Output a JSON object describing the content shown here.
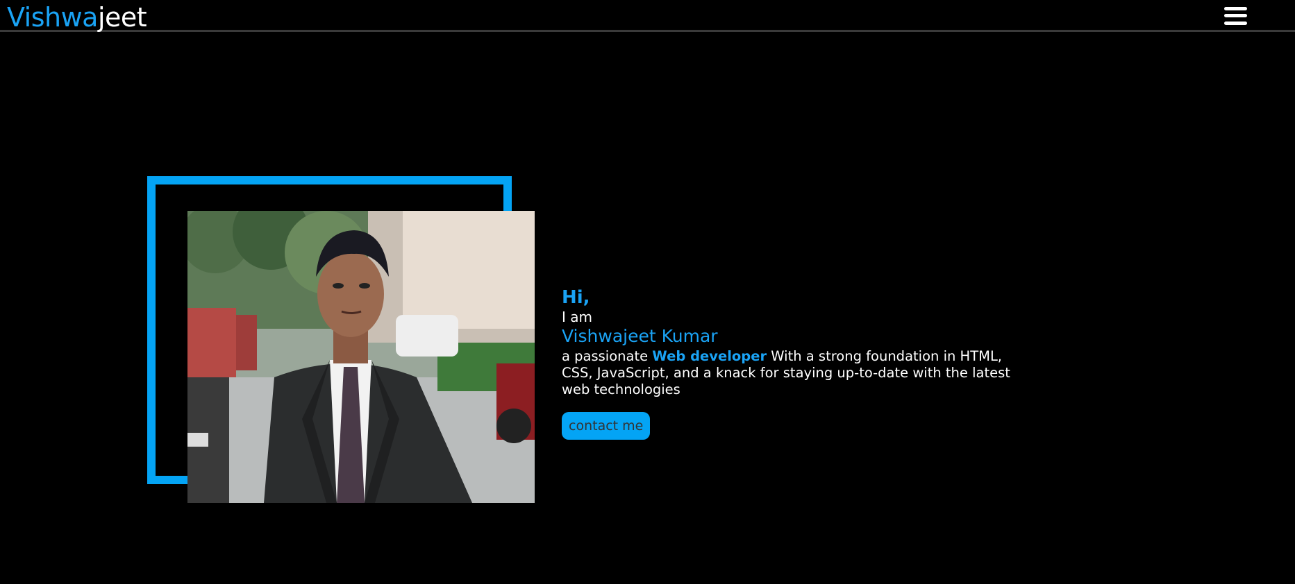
{
  "header": {
    "logo_part1": "Vishwa",
    "logo_part2": "jeet",
    "menu_icon": "hamburger-menu-icon"
  },
  "hero": {
    "greeting": "Hi,",
    "iam": "I am",
    "name": "Vishwajeet Kumar",
    "desc_prefix": "a passionate ",
    "desc_highlight": "Web developer",
    "desc_suffix": " With a strong foundation in HTML, CSS, JavaScript, and a knack for staying up-to-date with the latest web technologies",
    "contact_button": "contact me"
  },
  "colors": {
    "accent": "#04a4f5",
    "background": "#000000",
    "text": "#ffffff"
  }
}
